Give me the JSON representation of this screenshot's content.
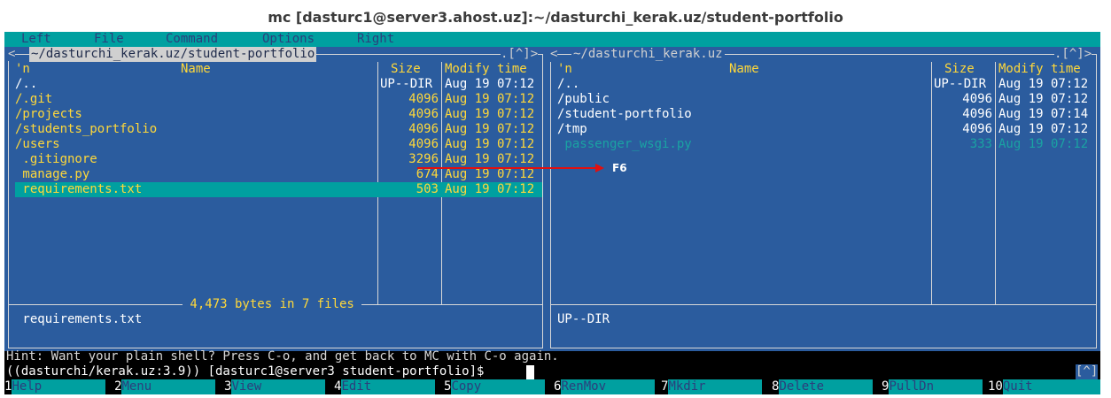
{
  "window": {
    "title": "mc [dasturc1@server3.ahost.uz]:~/dasturchi_kerak.uz/student-portfolio"
  },
  "menu": [
    "Left",
    "File",
    "Command",
    "Options",
    "Right"
  ],
  "left_panel": {
    "path": "~/dasturchi_kerak.uz/student-portfolio",
    "corner": ".[^]>",
    "columns": {
      "sort": "'n",
      "name": "Name",
      "size": "Size",
      "mtime": "Modify time"
    },
    "rows": [
      {
        "name": "/..",
        "size": "UP--DIR",
        "mtime": "Aug 19 07:12"
      },
      {
        "name": "/.git",
        "size": "4096",
        "mtime": "Aug 19 07:12"
      },
      {
        "name": "/projects",
        "size": "4096",
        "mtime": "Aug 19 07:12"
      },
      {
        "name": "/students_portfolio",
        "size": "4096",
        "mtime": "Aug 19 07:12"
      },
      {
        "name": "/users",
        "size": "4096",
        "mtime": "Aug 19 07:12"
      },
      {
        "name": " .gitignore",
        "size": "3296",
        "mtime": "Aug 19 07:12"
      },
      {
        "name": " manage.py",
        "size": "674",
        "mtime": "Aug 19 07:12"
      },
      {
        "name": " requirements.txt",
        "size": "503",
        "mtime": "Aug 19 07:12"
      }
    ],
    "summary": " 4,473 bytes in 7 files ",
    "status": " requirements.txt"
  },
  "right_panel": {
    "path": "~/dasturchi_kerak.uz",
    "corner": ".[^]>",
    "columns": {
      "sort": "'n",
      "name": "Name",
      "size": "Size",
      "mtime": "Modify time"
    },
    "rows": [
      {
        "name": "/..",
        "size": "UP--DIR",
        "mtime": "Aug 19 07:12"
      },
      {
        "name": "/public",
        "size": "4096",
        "mtime": "Aug 19 07:12"
      },
      {
        "name": "/student-portfolio",
        "size": "4096",
        "mtime": "Aug 19 07:14"
      },
      {
        "name": "/tmp",
        "size": "4096",
        "mtime": "Aug 19 07:12"
      },
      {
        "name": " passenger_wsgi.py",
        "size": "333",
        "mtime": "Aug 19 07:12"
      }
    ],
    "status": "UP--DIR"
  },
  "hint": "Hint: Want your plain shell? Press C-o, and get back to MC with C-o again.",
  "prompt": "((dasturchi/kerak.uz:3.9)) [dasturc1@server3 student-portfolio]$ ",
  "indicator": "[^]",
  "fkeys": [
    {
      "num": "1",
      "label": "Help"
    },
    {
      "num": "2",
      "label": "Menu"
    },
    {
      "num": "3",
      "label": "View"
    },
    {
      "num": "4",
      "label": "Edit"
    },
    {
      "num": "5",
      "label": "Copy"
    },
    {
      "num": "6",
      "label": "RenMov"
    },
    {
      "num": "7",
      "label": "Mkdir"
    },
    {
      "num": "8",
      "label": "Delete"
    },
    {
      "num": "9",
      "label": "PullDn"
    },
    {
      "num": "10",
      "label": "Quit"
    }
  ],
  "annotation": {
    "label": "F6",
    "color": "#e01010"
  },
  "colors": {
    "panel_bg": "#2b5c9e",
    "accent": "#00a0a0",
    "highlight_text": "#ffd83a"
  }
}
